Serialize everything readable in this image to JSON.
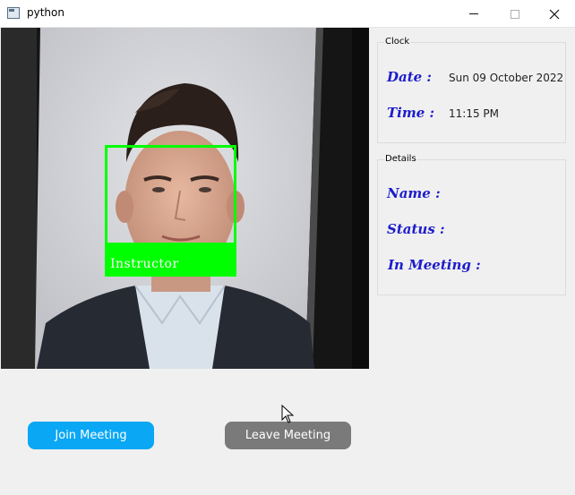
{
  "window": {
    "title": "python"
  },
  "video": {
    "face_label": "Instructor"
  },
  "clock": {
    "group_title": "Clock",
    "date_label": "Date :",
    "date_value": "Sun 09 October 2022",
    "time_label": "Time :",
    "time_value": "11:15 PM"
  },
  "details": {
    "group_title": "Details",
    "name_label": "Name :",
    "status_label": "Status :",
    "meeting_label": "In Meeting :"
  },
  "buttons": {
    "join": "Join Meeting",
    "leave": "Leave Meeting"
  },
  "colors": {
    "join": "#0aa7f5",
    "leave": "#7a7a7a",
    "label": "#1c1ccc",
    "detect_box": "#00ff00"
  },
  "icons": [
    "app-icon",
    "minimize-icon",
    "maximize-icon",
    "close-icon",
    "mouse-cursor-icon"
  ]
}
